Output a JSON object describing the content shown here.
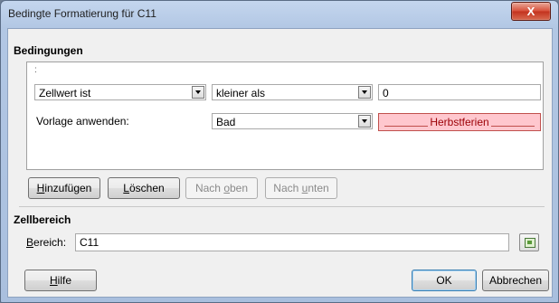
{
  "window": {
    "title": "Bedingte Formatierung für C11",
    "close_label": "X"
  },
  "conditions": {
    "heading": "Bedingungen",
    "hint": ":",
    "condition_type": "Zellwert ist",
    "operator": "kleiner als",
    "value": "0",
    "apply_style_label": "Vorlage anwenden:",
    "style": "Bad",
    "preview_text": "Herbstferien"
  },
  "buttons": {
    "add": {
      "pre": "",
      "u": "H",
      "post": "inzufügen"
    },
    "delete": {
      "pre": "",
      "u": "L",
      "post": "öschen"
    },
    "up": {
      "pre": "Nach ",
      "u": "o",
      "post": "ben"
    },
    "down": {
      "pre": "Nach ",
      "u": "u",
      "post": "nten"
    },
    "help": {
      "pre": "",
      "u": "H",
      "post": "ilfe"
    },
    "ok": "OK",
    "cancel": "Abbrechen"
  },
  "range": {
    "heading": "Zellbereich",
    "label_u": "B",
    "label_rest": "ereich:",
    "value": "C11"
  },
  "colors": {
    "preview_bg": "#ffc7ce",
    "preview_text": "#9c0006",
    "close_button": "#c3321e"
  }
}
